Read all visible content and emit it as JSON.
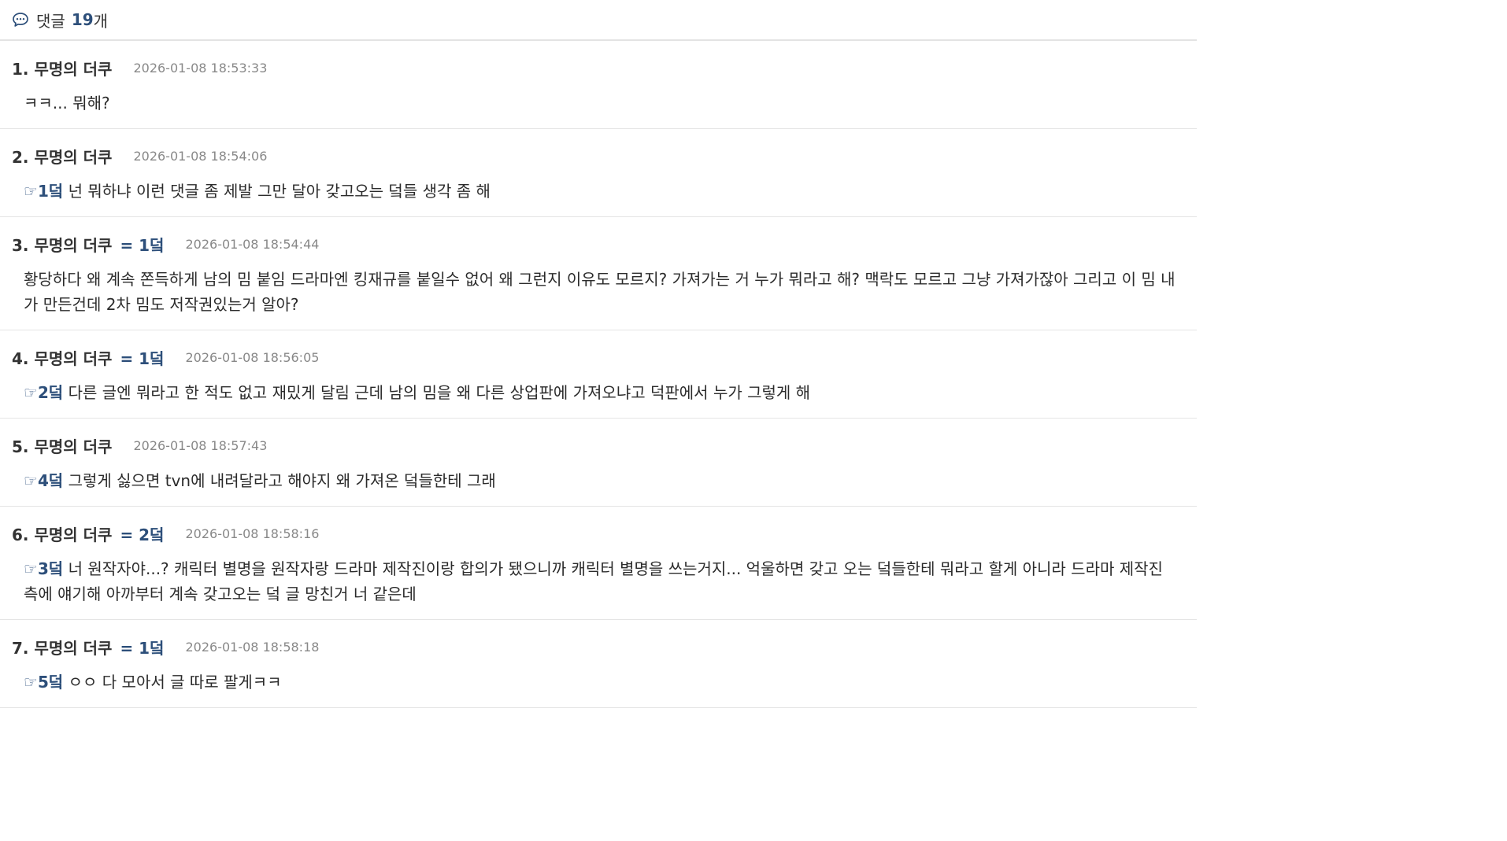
{
  "header": {
    "icon": "speech-bubble-icon",
    "label": "댓글",
    "count": "19",
    "suffix": "개"
  },
  "comments": [
    {
      "number": "1.",
      "author": "무명의 더쿠",
      "reply_to": "",
      "time": "2026-01-08 18:53:33",
      "ref": "",
      "text": "ㅋㅋ... 뭐해?"
    },
    {
      "number": "2.",
      "author": "무명의 더쿠",
      "reply_to": "",
      "time": "2026-01-08 18:54:06",
      "ref": "1덬",
      "text": "넌 뭐하냐 이런 댓글 좀 제발 그만 달아 갖고오는 덬들 생각 좀 해"
    },
    {
      "number": "3.",
      "author": "무명의 더쿠",
      "reply_to": "= 1덬",
      "time": "2026-01-08 18:54:44",
      "ref": "",
      "text": "황당하다 왜 계속 쫀득하게 남의 밈 붙임 드라마엔 킹재규를 붙일수 없어 왜 그런지 이유도 모르지? 가져가는 거 누가 뭐라고 해? 맥락도 모르고 그냥 가져가잖아 그리고 이 밈 내가 만든건데 2차 밈도 저작권있는거 알아?"
    },
    {
      "number": "4.",
      "author": "무명의 더쿠",
      "reply_to": "= 1덬",
      "time": "2026-01-08 18:56:05",
      "ref": "2덬",
      "text": "다른 글엔 뭐라고 한 적도 없고 재밌게 달림 근데 남의 밈을 왜 다른 상업판에 가져오냐고 덕판에서 누가 그렇게 해"
    },
    {
      "number": "5.",
      "author": "무명의 더쿠",
      "reply_to": "",
      "time": "2026-01-08 18:57:43",
      "ref": "4덬",
      "text": "그렇게 싫으면 tvn에 내려달라고 해야지 왜 가져온 덬들한테 그래"
    },
    {
      "number": "6.",
      "author": "무명의 더쿠",
      "reply_to": "= 2덬",
      "time": "2026-01-08 18:58:16",
      "ref": "3덬",
      "text": "너 원작자야...? 캐릭터 별명을 원작자랑 드라마 제작진이랑 합의가 됐으니까 캐릭터 별명을 쓰는거지... 억울하면 갖고 오는 덬들한테 뭐라고 할게 아니라 드라마 제작진 측에 얘기해 아까부터 계속 갖고오는 덬 글 망친거 너 같은데"
    },
    {
      "number": "7.",
      "author": "무명의 더쿠",
      "reply_to": "= 1덬",
      "time": "2026-01-08 18:58:18",
      "ref": "5덬",
      "text": "ㅇㅇ 다 모아서 글 따로 팔게ㅋㅋ"
    }
  ]
}
